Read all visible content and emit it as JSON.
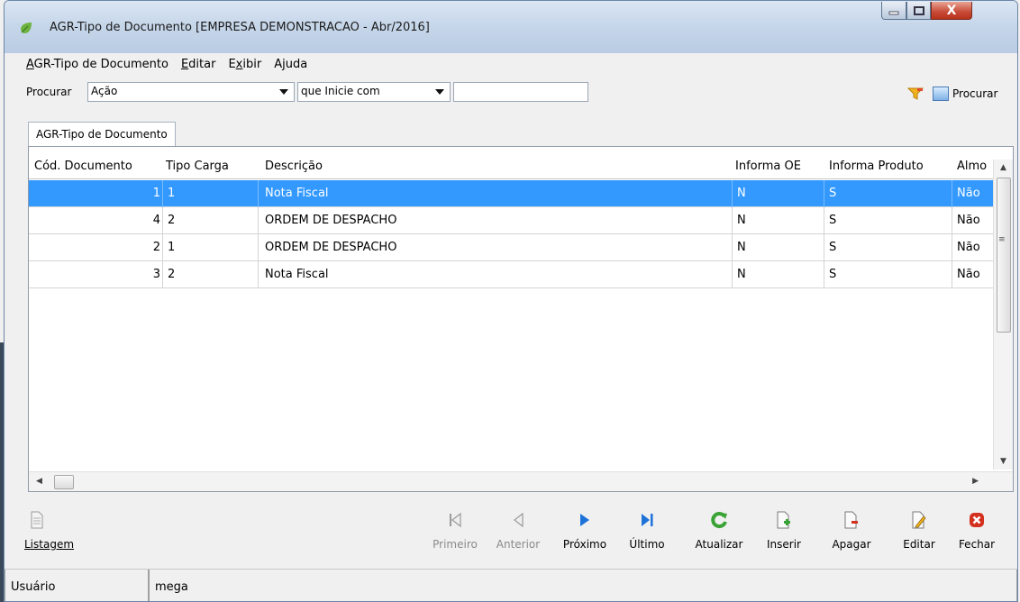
{
  "window": {
    "title": "AGR-Tipo de Documento [EMPRESA DEMONSTRACAO - Abr/2016]",
    "minimize": "–",
    "maximize": "▢",
    "close": "X"
  },
  "menu": [
    {
      "label": "AGR-Tipo de Documento",
      "accel": "A",
      "rest": "GR-Tipo de Documento"
    },
    {
      "label": "Editar",
      "accel": "E",
      "rest": "ditar"
    },
    {
      "label": "Exibir",
      "accel": "x",
      "pre": "E",
      "rest": "ibir"
    },
    {
      "label": "Ajuda",
      "accel": "j",
      "pre": "A",
      "rest": "uda"
    }
  ],
  "search": {
    "label": "Procurar",
    "field_value": "Ação",
    "condition_value": "que Inicie com",
    "text_value": "",
    "button_label": "Procurar"
  },
  "tab": {
    "label": "AGR-Tipo de Documento"
  },
  "table": {
    "columns": [
      "Cód. Documento",
      "Tipo Carga",
      "Descrição",
      "Informa OE",
      "Informa Produto",
      "Almo"
    ],
    "rows": [
      {
        "cod": "1",
        "tipo": "1",
        "descricao": "Nota Fiscal",
        "oe": "N",
        "produto": "S",
        "almox": "Não"
      },
      {
        "cod": "4",
        "tipo": "2",
        "descricao": "ORDEM DE DESPACHO",
        "oe": "N",
        "produto": "S",
        "almox": "Não"
      },
      {
        "cod": "2",
        "tipo": "1",
        "descricao": "ORDEM DE DESPACHO",
        "oe": "N",
        "produto": "S",
        "almox": "Não"
      },
      {
        "cod": "3",
        "tipo": "2",
        "descricao": "Nota Fiscal",
        "oe": "N",
        "produto": "S",
        "almox": "Não"
      }
    ],
    "selected_row": 0
  },
  "toolbar": {
    "listagem": "Listagem",
    "primeiro": "Primeiro",
    "anterior": "Anterior",
    "proximo": "Próximo",
    "ultimo": "Último",
    "atualizar": "Atualizar",
    "inserir": "Inserir",
    "apagar": "Apagar",
    "editar": "Editar",
    "fechar": "Fechar"
  },
  "status": {
    "label": "Usuário",
    "user": "mega"
  },
  "colors": {
    "selection": "#3399ff",
    "refresh_green": "#3aa335",
    "close_red": "#d4301e",
    "nav_blue": "#1e73d8"
  }
}
